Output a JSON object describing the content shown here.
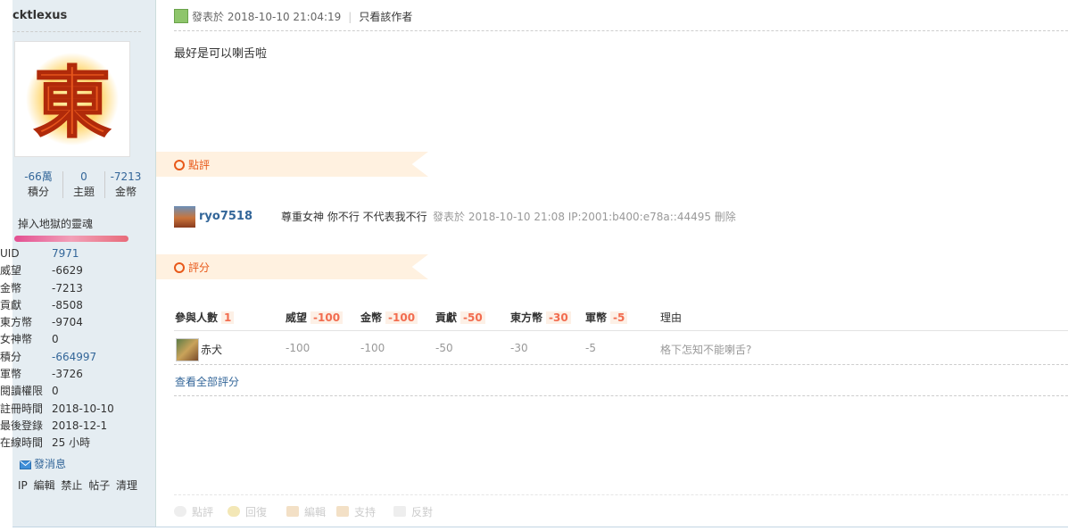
{
  "profile": {
    "username": "cktlexus",
    "avatar_char": "東",
    "stats": [
      {
        "value": "-66萬",
        "label": "積分"
      },
      {
        "value": "0",
        "label": "主題"
      },
      {
        "value": "-7213",
        "label": "金幣"
      }
    ],
    "rank_title": "掉入地獄的靈魂",
    "info": [
      {
        "key": "UID",
        "value": "7971",
        "link": true
      },
      {
        "key": "威望",
        "value": "-6629"
      },
      {
        "key": "金幣",
        "value": "-7213"
      },
      {
        "key": "貢獻",
        "value": "-8508"
      },
      {
        "key": "東方幣",
        "value": "-9704"
      },
      {
        "key": "女神幣",
        "value": "0"
      },
      {
        "key": "積分",
        "value": "-664997",
        "link": true
      },
      {
        "key": "軍幣",
        "value": "-3726"
      },
      {
        "key": "閱讀權限",
        "value": "0"
      },
      {
        "key": "註冊時間",
        "value": "2018-10-10"
      },
      {
        "key": "最後登錄",
        "value": "2018-12-1"
      },
      {
        "key": "在線時間",
        "value": "25 小時"
      }
    ],
    "send_message": "發消息",
    "admin_links": "IP 編輯 禁止 帖子 清理"
  },
  "post": {
    "meta_prefix": "發表於",
    "timestamp": "2018-10-10 21:04:19",
    "author_only": "只看該作者",
    "body": "最好是可以喇舌啦"
  },
  "comments_section": {
    "title": "點評",
    "items": [
      {
        "user": "ryo7518",
        "text": "尊重女神 你不行 不代表我不行",
        "meta": "發表於 2018-10-10 21:08 IP:2001:b400:e78a::44495 刪除"
      }
    ]
  },
  "rating_section": {
    "title": "評分",
    "headers": [
      {
        "label": "參與人數",
        "value": "1"
      },
      {
        "label": "威望",
        "value": "-100"
      },
      {
        "label": "金幣",
        "value": "-100"
      },
      {
        "label": "貢獻",
        "value": "-50"
      },
      {
        "label": "東方幣",
        "value": "-30"
      },
      {
        "label": "軍幣",
        "value": "-5"
      }
    ],
    "reason_header": "理由",
    "rows": [
      {
        "user": "赤犬",
        "values": [
          "-100",
          "-100",
          "-50",
          "-30",
          "-5"
        ],
        "reason": "格下怎知不能喇舌?"
      }
    ],
    "view_all": "查看全部評分"
  },
  "actions": [
    "點評",
    "回復",
    "編輯",
    "支持",
    "反對"
  ]
}
